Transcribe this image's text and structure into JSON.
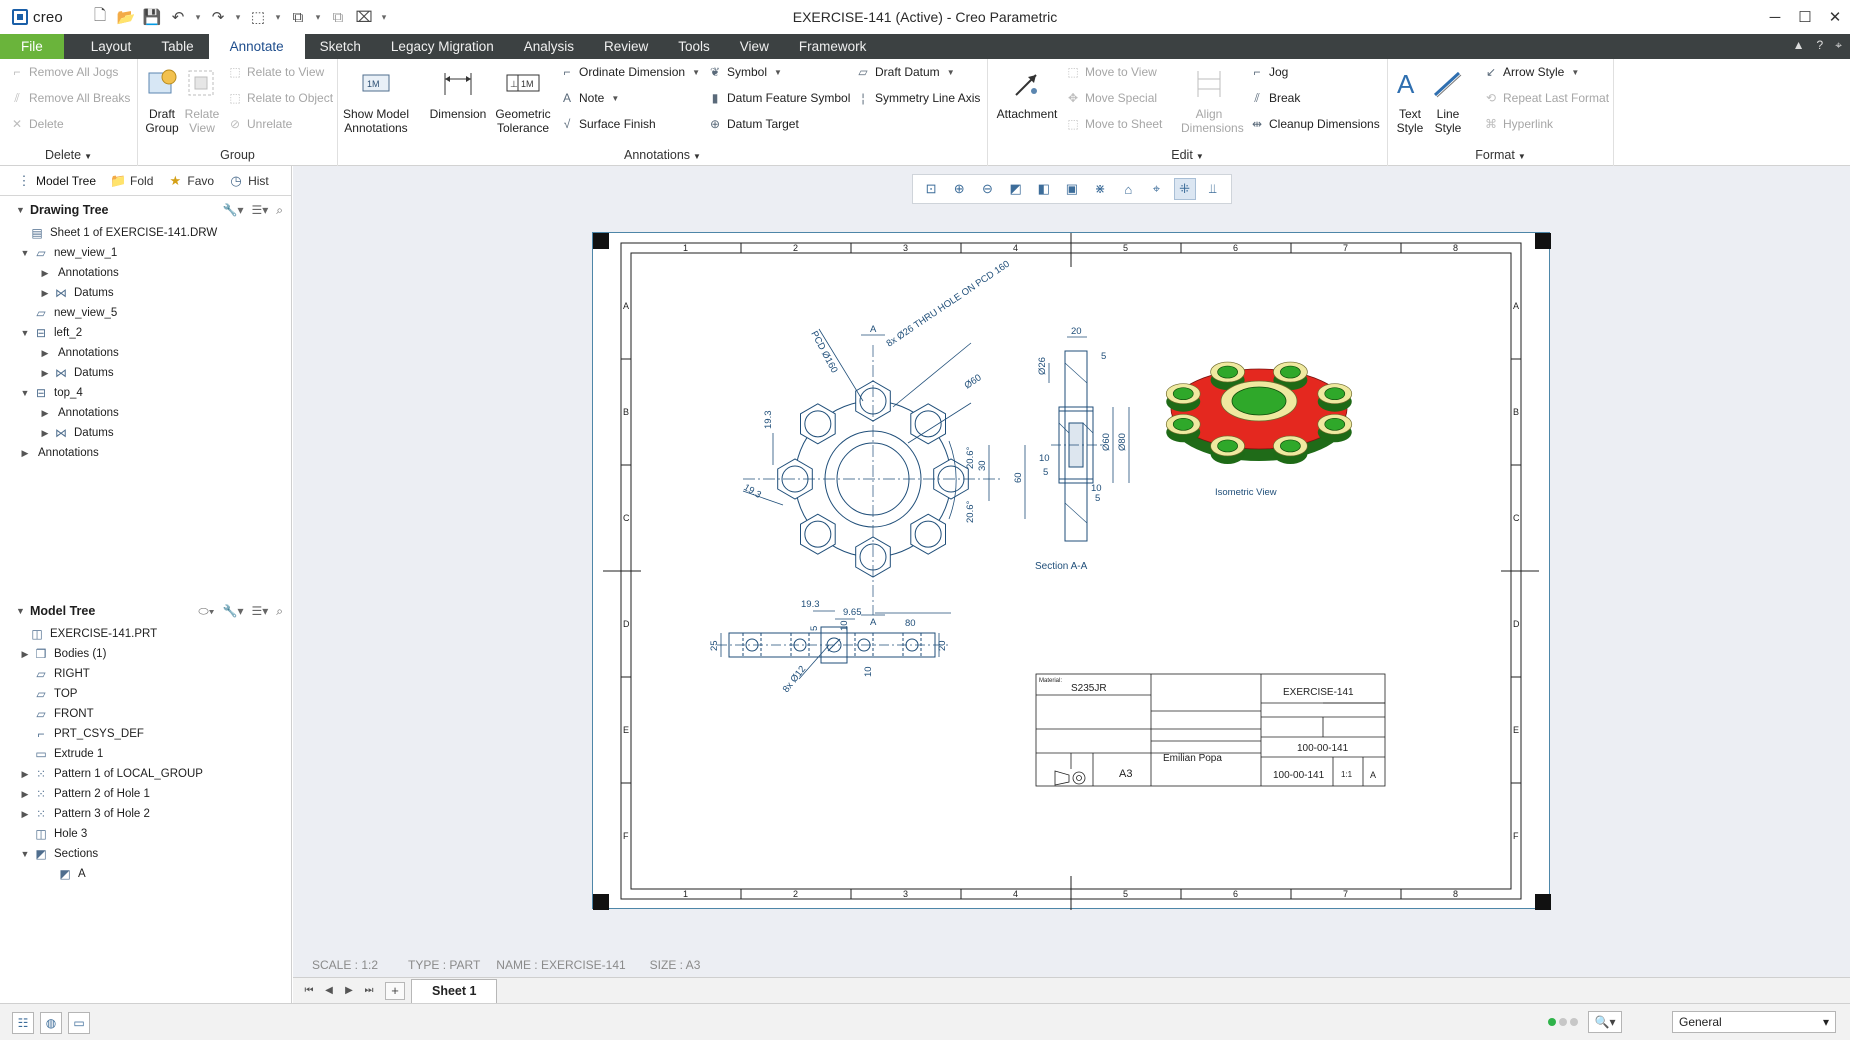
{
  "app": {
    "logo": "creo",
    "window_title": "EXERCISE-141 (Active) - Creo Parametric"
  },
  "ribbon_tabs": [
    "File",
    "Layout",
    "Table",
    "Annotate",
    "Sketch",
    "Legacy Migration",
    "Analysis",
    "Review",
    "Tools",
    "View",
    "Framework"
  ],
  "active_tab": "Annotate",
  "ribbon": {
    "delete_group": {
      "label": "Delete",
      "items": [
        "Remove All Jogs",
        "Remove All Breaks",
        "Delete"
      ]
    },
    "group_group": {
      "label": "Group",
      "draft_group": "Draft Group",
      "relate_view": "Relate View",
      "items": [
        "Relate to View",
        "Relate to Object",
        "Unrelate"
      ]
    },
    "annotations_group": {
      "label": "Annotations",
      "show_model_annotations": "Show Model Annotations",
      "dimension": "Dimension",
      "geometric_tolerance": "Geometric Tolerance",
      "col1": [
        "Ordinate Dimension",
        "Note",
        "Surface Finish"
      ],
      "col2": [
        "Symbol",
        "Datum Feature Symbol",
        "Datum Target"
      ],
      "col3": [
        "Draft Datum",
        "Symmetry Line Axis"
      ]
    },
    "edit_group": {
      "label": "Edit",
      "attachment": "Attachment",
      "move_items": [
        "Move to View",
        "Move Special",
        "Move to Sheet"
      ],
      "align_dimensions": "Align Dimensions",
      "items": [
        "Jog",
        "Break",
        "Cleanup Dimensions"
      ]
    },
    "format_group": {
      "label": "Format",
      "text_style": "Text Style",
      "line_style": "Line Style",
      "items": [
        "Arrow Style",
        "Repeat Last Format",
        "Hyperlink"
      ]
    }
  },
  "nav_tabs": [
    "Model Tree",
    "Fold",
    "Favo",
    "Hist"
  ],
  "drawing_tree": {
    "title": "Drawing Tree",
    "nodes": [
      {
        "label": "Sheet 1 of EXERCISE-141.DRW",
        "level": 0,
        "exp": "",
        "icon": "sheet-icon"
      },
      {
        "label": "new_view_1",
        "level": 0,
        "exp": "▼",
        "icon": "view-icon"
      },
      {
        "label": "Annotations",
        "level": 1,
        "exp": "▶",
        "icon": ""
      },
      {
        "label": "Datums",
        "level": 1,
        "exp": "▶",
        "icon": "datum-icon"
      },
      {
        "label": "new_view_5",
        "level": 0,
        "exp": "",
        "icon": "view-icon"
      },
      {
        "label": "left_2",
        "level": 0,
        "exp": "▼",
        "icon": "projection-view-icon"
      },
      {
        "label": "Annotations",
        "level": 1,
        "exp": "▶",
        "icon": ""
      },
      {
        "label": "Datums",
        "level": 1,
        "exp": "▶",
        "icon": "datum-icon"
      },
      {
        "label": "top_4",
        "level": 0,
        "exp": "▼",
        "icon": "projection-view-icon"
      },
      {
        "label": "Annotations",
        "level": 1,
        "exp": "▶",
        "icon": ""
      },
      {
        "label": "Datums",
        "level": 1,
        "exp": "▶",
        "icon": "datum-icon"
      },
      {
        "label": "Annotations",
        "level": -1,
        "exp": "▶",
        "icon": ""
      }
    ]
  },
  "model_tree": {
    "title": "Model Tree",
    "nodes": [
      {
        "label": "EXERCISE-141.PRT",
        "exp": "",
        "icon": "part-icon"
      },
      {
        "label": "Bodies (1)",
        "exp": "▶",
        "icon": "bodies-icon"
      },
      {
        "label": "RIGHT",
        "exp": "",
        "icon": "plane-icon"
      },
      {
        "label": "TOP",
        "exp": "",
        "icon": "plane-icon"
      },
      {
        "label": "FRONT",
        "exp": "",
        "icon": "plane-icon"
      },
      {
        "label": "PRT_CSYS_DEF",
        "exp": "",
        "icon": "csys-icon"
      },
      {
        "label": "Extrude 1",
        "exp": "",
        "icon": "extrude-icon"
      },
      {
        "label": "Pattern 1 of LOCAL_GROUP",
        "exp": "▶",
        "icon": "pattern-icon"
      },
      {
        "label": "Pattern 2 of Hole 1",
        "exp": "▶",
        "icon": "pattern-icon"
      },
      {
        "label": "Pattern 3 of Hole 2",
        "exp": "▶",
        "icon": "pattern-icon"
      },
      {
        "label": "Hole 3",
        "exp": "",
        "icon": "hole-icon"
      },
      {
        "label": "Sections",
        "exp": "▼",
        "icon": "sections-icon"
      },
      {
        "label": "A",
        "exp": "",
        "icon": "section-icon"
      }
    ]
  },
  "drawing": {
    "zone_cols": [
      "1",
      "2",
      "3",
      "4",
      "5",
      "6",
      "7",
      "8"
    ],
    "zone_rows": [
      "A",
      "B",
      "C",
      "D",
      "E",
      "F"
    ],
    "front_dims": [
      "PCD Ø160",
      "8x Ø26 THRU HOLE ON PCD 160",
      "Ø60",
      "19.3",
      "19.3",
      "20.6°",
      "20.6°",
      "30",
      "60",
      "80",
      "A",
      "A"
    ],
    "side_dims": [
      "20",
      "5",
      "Ø26",
      "Ø60",
      "Ø80",
      "10",
      "5",
      "10",
      "5"
    ],
    "top_dims": [
      "19.3",
      "9.65",
      "5",
      "10",
      "25",
      "20",
      "10",
      "8x Ø12"
    ],
    "section_label": "Section A-A",
    "iso_label": "Isometric View",
    "title_block": {
      "material_label": "Material:",
      "material": "S235JR",
      "part_name": "EXERCISE-141",
      "drawing_no": "100-00-141",
      "drawing_no_2": "100-00-141",
      "author": "Emilian Popa",
      "size": "A3",
      "scale": "1:1",
      "rev": "A"
    }
  },
  "status_info": {
    "scale": "SCALE : 1:2",
    "type": "TYPE : PART",
    "name": "NAME : EXERCISE-141",
    "size": "SIZE : A3"
  },
  "sheet_tab": "Sheet 1",
  "selection_filter": "General",
  "colors": {
    "file_tab": "#6ab43b",
    "tab_bar": "#3c4142",
    "active_tab_text": "#1e4d8c",
    "drawing_line": "#1f4e79",
    "iso_red": "#e4281f",
    "iso_green": "#2fa82a",
    "iso_yellow": "#efe9a0"
  }
}
